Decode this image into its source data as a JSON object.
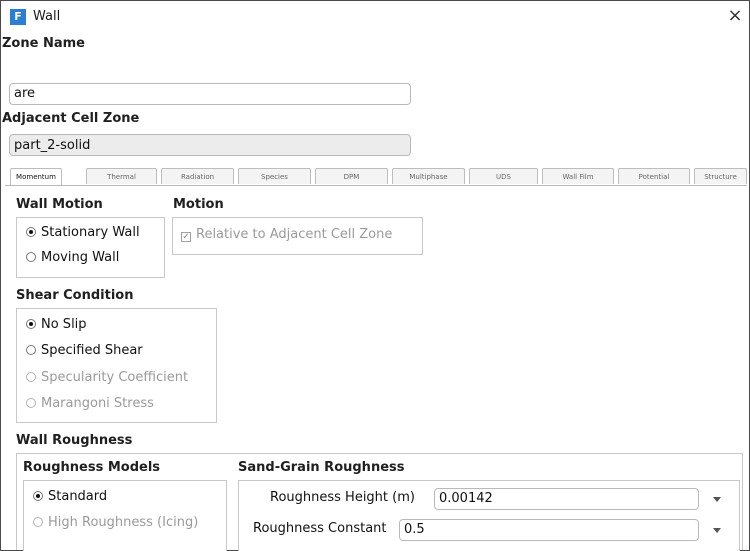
{
  "window": {
    "title": "Wall",
    "close_glyph": "×",
    "app_icon_letter": "F"
  },
  "zone": {
    "zone_name_label": "Zone Name",
    "zone_name_value": "are",
    "adjacent_label": "Adjacent Cell Zone",
    "adjacent_value": "part_2-solid"
  },
  "tabs": [
    "Momentum",
    "Thermal",
    "Radiation",
    "Species",
    "DPM",
    "Multiphase",
    "UDS",
    "Wall Film",
    "Potential",
    "Structure"
  ],
  "active_tab": "Momentum",
  "wall_motion": {
    "heading": "Wall Motion",
    "options": [
      "Stationary Wall",
      "Moving Wall"
    ],
    "selected": "Stationary Wall"
  },
  "motion": {
    "heading": "Motion",
    "relative_label": "Relative to Adjacent Cell Zone",
    "relative_checked": true
  },
  "shear": {
    "heading": "Shear Condition",
    "options": [
      "No Slip",
      "Specified Shear",
      "Specularity Coefficient",
      "Marangoni Stress"
    ],
    "selected": "No Slip"
  },
  "roughness": {
    "heading": "Wall Roughness",
    "models_heading": "Roughness Models",
    "models": [
      "Standard",
      "High Roughness (Icing)"
    ],
    "selected_model": "Standard",
    "sand_heading": "Sand-Grain Roughness",
    "height_label": "Roughness Height (m)",
    "height_value": "0.00142",
    "constant_label": "Roughness Constant",
    "constant_value": "0.5"
  }
}
